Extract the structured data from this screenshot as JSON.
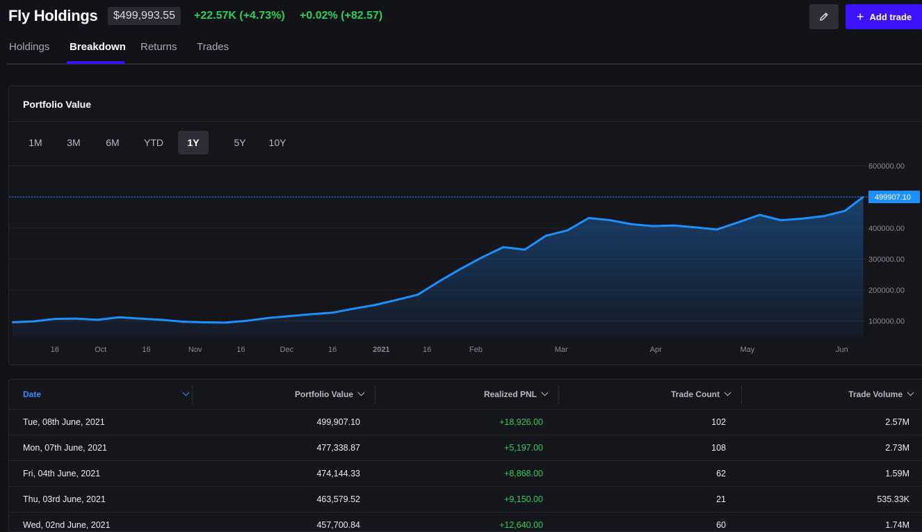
{
  "header": {
    "title": "Fly Holdings",
    "portfolio_value": "$499,993.55",
    "change_total": "+22.57K (+4.73%)",
    "change_day": "+0.02% (+82.57)",
    "add_trade_label": "Add trade",
    "accent_color": "#3d12ff"
  },
  "tabs": [
    {
      "label": "Holdings",
      "active": false
    },
    {
      "label": "Breakdown",
      "active": true
    },
    {
      "label": "Returns",
      "active": false
    },
    {
      "label": "Trades",
      "active": false
    }
  ],
  "card": {
    "title": "Portfolio Value",
    "ranges": [
      {
        "label": "1M",
        "active": false
      },
      {
        "label": "3M",
        "active": false
      },
      {
        "label": "6M",
        "active": false
      },
      {
        "label": "YTD",
        "active": false
      },
      {
        "label": "1Y",
        "active": true
      },
      {
        "label": "5Y",
        "active": false
      },
      {
        "label": "10Y",
        "active": false
      }
    ]
  },
  "chart_data": {
    "type": "area",
    "title": "Portfolio Value",
    "xlabel": "",
    "ylabel": "",
    "ylim": [
      50000,
      610000
    ],
    "y_ticks": [
      "600000.00",
      "400000.00",
      "300000.00",
      "200000.00",
      "100000.00"
    ],
    "y_tick_values": [
      600000,
      400000,
      300000,
      200000,
      100000
    ],
    "x_tick_labels": [
      "16",
      "Oct",
      "16",
      "Nov",
      "16",
      "Dec",
      "16",
      "2021",
      "16",
      "Feb",
      "Mar",
      "Apr",
      "May",
      "Jun"
    ],
    "x_tick_dates": [
      "2020-09-16",
      "2020-10-01",
      "2020-10-16",
      "2020-11-01",
      "2020-11-16",
      "2020-12-01",
      "2020-12-16",
      "2021-01-01",
      "2021-01-16",
      "2021-02-01",
      "2021-03-01",
      "2021-04-01",
      "2021-05-01",
      "2021-06-01"
    ],
    "current_value_label": "499907.10",
    "current_value": 499907.1,
    "line_color": "#1e90ff",
    "grid": true,
    "series": [
      {
        "dates": [
          "2020-09-02",
          "2020-09-09",
          "2020-09-16",
          "2020-09-23",
          "2020-09-30",
          "2020-10-07",
          "2020-10-14",
          "2020-10-21",
          "2020-10-28",
          "2020-11-04",
          "2020-11-11",
          "2020-11-18",
          "2020-11-25",
          "2020-12-02",
          "2020-12-09",
          "2020-12-16",
          "2020-12-23",
          "2020-12-30",
          "2021-01-06",
          "2021-01-13",
          "2021-01-20",
          "2021-01-27",
          "2021-02-03",
          "2021-02-10",
          "2021-02-17",
          "2021-02-24",
          "2021-03-03",
          "2021-03-10",
          "2021-03-17",
          "2021-03-24",
          "2021-03-31",
          "2021-04-07",
          "2021-04-14",
          "2021-04-21",
          "2021-04-28",
          "2021-05-05",
          "2021-05-12",
          "2021-05-19",
          "2021-05-26",
          "2021-06-02",
          "2021-06-08"
        ],
        "values": [
          96000,
          99000,
          107000,
          108000,
          104000,
          112000,
          108000,
          104000,
          98000,
          96000,
          95000,
          101000,
          110000,
          116000,
          122000,
          127000,
          140000,
          152000,
          168000,
          185000,
          228000,
          268000,
          305000,
          338000,
          330000,
          375000,
          392000,
          432000,
          425000,
          412000,
          406000,
          408000,
          402000,
          395000,
          418000,
          442000,
          425000,
          430000,
          438000,
          455000,
          499907.1
        ]
      }
    ]
  },
  "table": {
    "columns": [
      "Date",
      "Portfolio Value",
      "Realized PNL",
      "Trade Count",
      "Trade Volume"
    ],
    "rows": [
      [
        "Tue, 08th June, 2021",
        "499,907.10",
        "+18,926.00",
        "102",
        "2.57M"
      ],
      [
        "Mon, 07th June, 2021",
        "477,338.87",
        "+5,197.00",
        "108",
        "2.73M"
      ],
      [
        "Fri, 04th June, 2021",
        "474,144.33",
        "+8,868.00",
        "62",
        "1.59M"
      ],
      [
        "Thu, 03rd June, 2021",
        "463,579.52",
        "+9,150.00",
        "21",
        "535.33K"
      ],
      [
        "Wed, 02nd June, 2021",
        "457,700.84",
        "+12,640.00",
        "60",
        "1.74M"
      ]
    ]
  }
}
